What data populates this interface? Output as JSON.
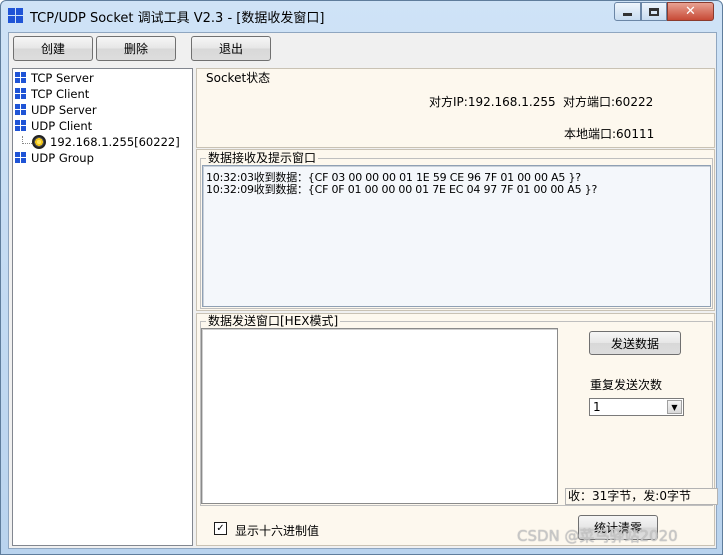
{
  "window": {
    "title": "TCP/UDP Socket 调试工具 V2.3 - [数据收发窗口]",
    "controls": {
      "minimize": "minimize",
      "maximize": "maximize",
      "close": "✕"
    }
  },
  "toolbar": {
    "create": "创建",
    "delete": "删除",
    "exit": "退出"
  },
  "tree": {
    "items": [
      {
        "label": "TCP Server"
      },
      {
        "label": "TCP Client"
      },
      {
        "label": "UDP Server"
      },
      {
        "label": "UDP Client"
      },
      {
        "label": "192.168.1.255[60222]"
      },
      {
        "label": "UDP Group"
      }
    ]
  },
  "socket_status": {
    "label": "Socket状态",
    "peer_ip": "对方IP:192.168.1.255",
    "peer_port": "对方端口:60222",
    "local_port": "本地端口:60111"
  },
  "receive": {
    "label": "数据接收及提示窗口",
    "lines": [
      "10:32:03收到数据：{CF 03 00 00 00 01 1E 59 CE 96 7F 01 00 00 A5 }?",
      "10:32:09收到数据：{CF 0F 01 00 00 00 01 7E EC 04 97 7F 01 00 00 A5 }?"
    ]
  },
  "send": {
    "label": "数据发送窗口[HEX模式]",
    "text": "",
    "send_button": "发送数据",
    "repeat_label": "重复发送次数",
    "repeat_value": "1",
    "stats": "收：31字节，发:0字节",
    "hex_checkbox_label": "显示十六进制值",
    "hex_checked": true,
    "clear_stats_button": "统计清零"
  },
  "watermark": "CSDN @菜鸟驿站2020",
  "colors": {
    "title_bar": "#c4dbf3",
    "panel_bg": "#fdf8ee",
    "close_button": "#c74a36",
    "tree_icon": "#1f54d6"
  }
}
